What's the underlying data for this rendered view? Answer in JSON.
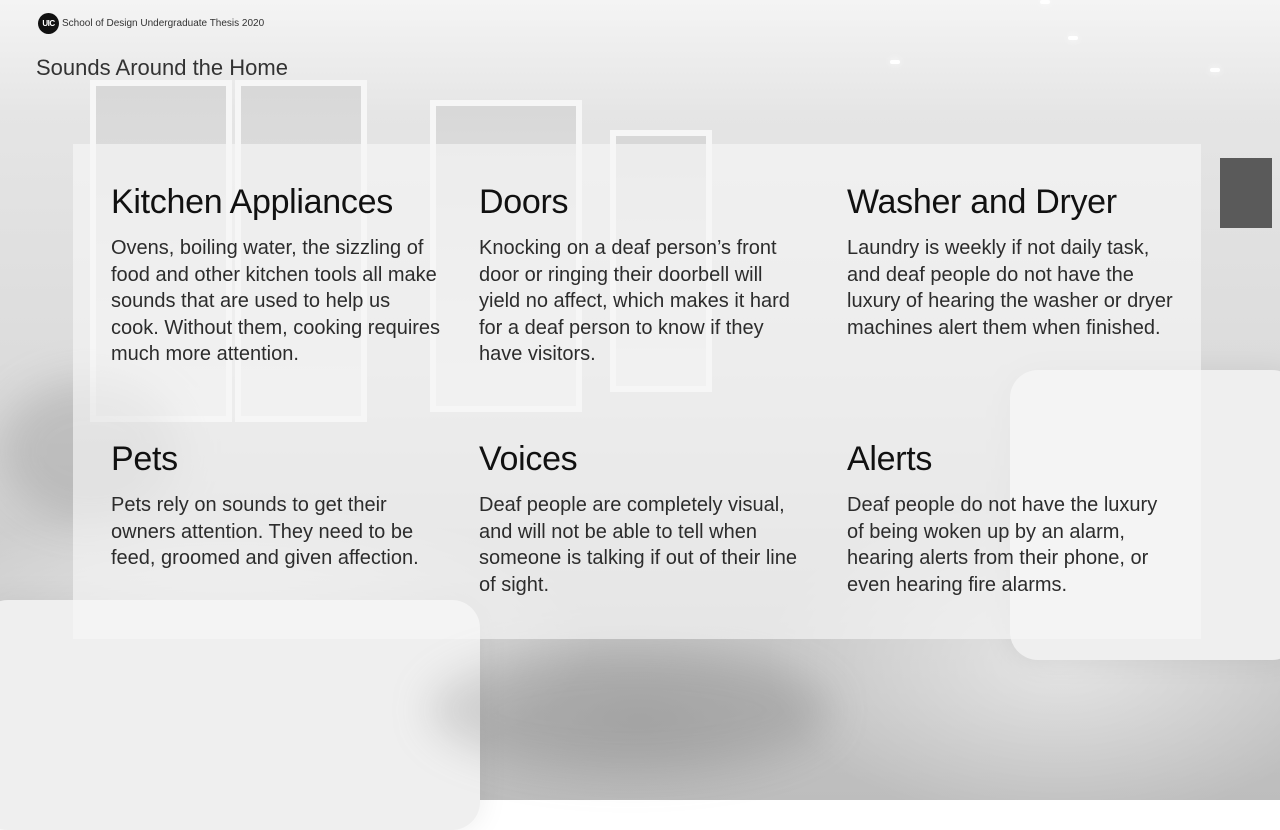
{
  "header": {
    "logo_text": "UIC",
    "subtitle": "School of Design Undergraduate Thesis 2020"
  },
  "page": {
    "title": "Sounds Around the Home"
  },
  "cards": [
    {
      "heading": "Kitchen Appliances",
      "body": "Ovens, boiling water, the sizzling of food and other kitchen tools all make sounds that are used to help us cook. Without them, cooking requires much more attention."
    },
    {
      "heading": "Doors",
      "body": "Knocking on a deaf person’s front door or ringing their doorbell will yield no affect, which makes it hard for a deaf person to know if they have visitors."
    },
    {
      "heading": "Washer and Dryer",
      "body": "Laundry is weekly if not daily task, and deaf people do not have the luxury of hearing the washer or dryer machines alert them when finished."
    },
    {
      "heading": "Pets",
      "body": "Pets rely on sounds to get their owners attention. They need to be feed, groomed and given affection."
    },
    {
      "heading": "Voices",
      "body": "Deaf people are completely visual, and will not be able to tell when someone is talking if out of their line of sight."
    },
    {
      "heading": "Alerts",
      "body": "Deaf people do not have the luxury of being woken up by an alarm, hearing alerts from their phone, or even hearing fire alarms."
    }
  ]
}
